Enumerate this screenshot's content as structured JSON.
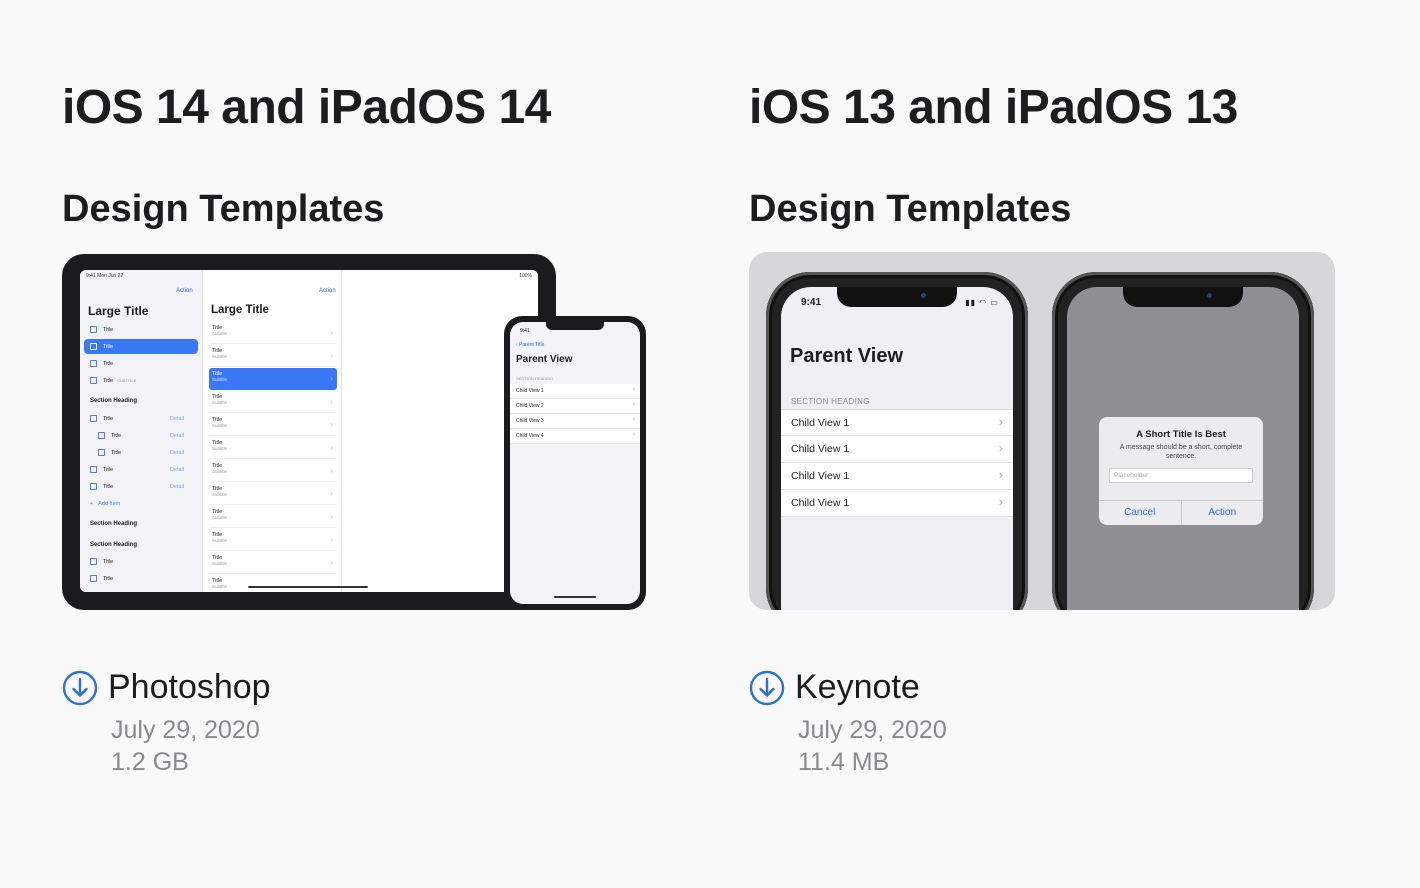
{
  "columns": {
    "left": {
      "os_title": "iOS 14 and iPadOS 14",
      "section_title": "Design Templates",
      "download": {
        "label": "Photoshop",
        "date": "July 29, 2020",
        "size": "1.2 GB",
        "icon": "download-circle-icon"
      },
      "preview": {
        "status_time": "9:41  Mon Jun 22",
        "status_right": "100%",
        "action": "Action",
        "large_title": "Large Title",
        "sidebar_items": [
          "Title",
          "Title",
          "Title",
          "Title",
          "Section Heading",
          "Title",
          "Title",
          "Title",
          "Title",
          "Title",
          "Add Item",
          "Section Heading",
          "Section Heading",
          "Title",
          "Title"
        ],
        "sidebar_subtitle": "SUBTITLE",
        "detail": "Detail",
        "list_title": "Title",
        "list_subtitle": "Subtitle",
        "phone": {
          "time": "9:41",
          "back": "Parent Title",
          "title": "Parent View",
          "section": "SECTION HEADING",
          "rows": [
            "Child View 1",
            "Child View 2",
            "Child View 3",
            "Child View 4"
          ]
        }
      }
    },
    "right": {
      "os_title": "iOS 13 and iPadOS 13",
      "section_title": "Design Templates",
      "download": {
        "label": "Keynote",
        "date": "July 29, 2020",
        "size": "11.4 MB",
        "icon": "download-circle-icon"
      },
      "preview": {
        "time": "9:41",
        "title": "Parent View",
        "section": "SECTION HEADING",
        "rows": [
          "Child View 1",
          "Child View 1",
          "Child View 1",
          "Child View 1"
        ],
        "alert": {
          "title": "A Short Title Is Best",
          "message": "A message should be a short, complete sentence.",
          "placeholder": "Placeholder",
          "cancel": "Cancel",
          "action": "Action"
        }
      }
    }
  },
  "colors": {
    "accent": "#2b6ff5",
    "icon_blue": "#2f6ee0",
    "meta_gray": "#8a8a8e",
    "background": "#f9f9fa"
  }
}
